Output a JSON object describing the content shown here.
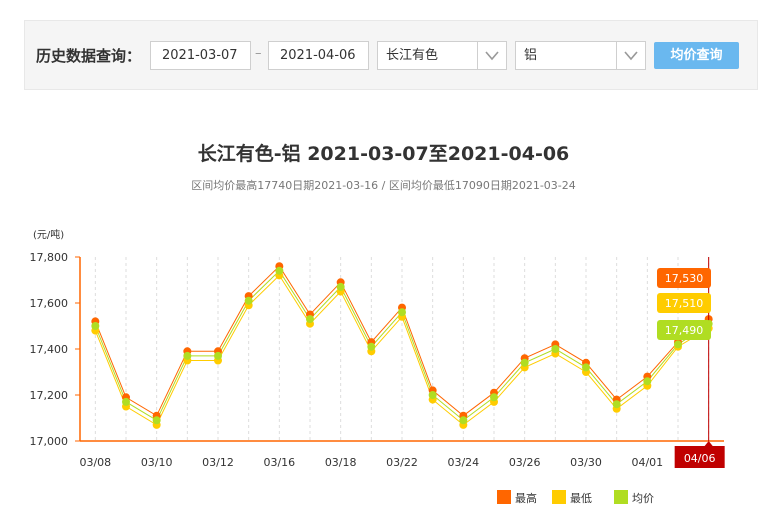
{
  "query": {
    "label": "历史数据查询：",
    "start_date": "2021-03-07",
    "separator": "–",
    "end_date": "2021-04-06",
    "market": "长江有色",
    "metal": "铝",
    "button": "均价查询"
  },
  "chart_data": {
    "type": "line",
    "title": "长江有色-铝 2021-03-07至2021-04-06",
    "subtitle": "区间均价最高17740日期2021-03-16 / 区间均价最低17090日期2021-03-24",
    "unit_label": "(元/吨)",
    "ylim": [
      17000,
      17800
    ],
    "yticks": [
      "17,000",
      "17,200",
      "17,400",
      "17,600",
      "17,800"
    ],
    "x": [
      "03/08",
      "03/09",
      "03/10",
      "03/11",
      "03/12",
      "03/15",
      "03/16",
      "03/17",
      "03/18",
      "03/19",
      "03/22",
      "03/23",
      "03/24",
      "03/25",
      "03/26",
      "03/29",
      "03/30",
      "03/31",
      "04/01",
      "04/02",
      "04/06"
    ],
    "xtick_labels": [
      "03/08",
      "03/10",
      "03/12",
      "03/16",
      "03/18",
      "03/22",
      "03/24",
      "03/26",
      "03/30",
      "04/01"
    ],
    "highlight_label": "04/06",
    "series": [
      {
        "name": "最高",
        "color": "#ff6600",
        "values": [
          17520,
          17190,
          17110,
          17390,
          17390,
          17630,
          17760,
          17550,
          17690,
          17430,
          17580,
          17220,
          17110,
          17210,
          17360,
          17420,
          17340,
          17180,
          17280,
          17430,
          17530
        ]
      },
      {
        "name": "最低",
        "color": "#ffcc00",
        "values": [
          17480,
          17150,
          17070,
          17350,
          17350,
          17590,
          17720,
          17510,
          17650,
          17390,
          17540,
          17180,
          17070,
          17170,
          17320,
          17380,
          17300,
          17140,
          17240,
          17410,
          17490
        ]
      },
      {
        "name": "均价",
        "color": "#b0dd22",
        "values": [
          17500,
          17170,
          17090,
          17370,
          17370,
          17610,
          17740,
          17530,
          17670,
          17410,
          17560,
          17200,
          17090,
          17190,
          17340,
          17400,
          17320,
          17160,
          17260,
          17420,
          17510
        ]
      }
    ],
    "last_value_labels": [
      "17,530",
      "17,510",
      "17,490"
    ],
    "grid": "vertical dashed",
    "legend": "bottom-right"
  }
}
